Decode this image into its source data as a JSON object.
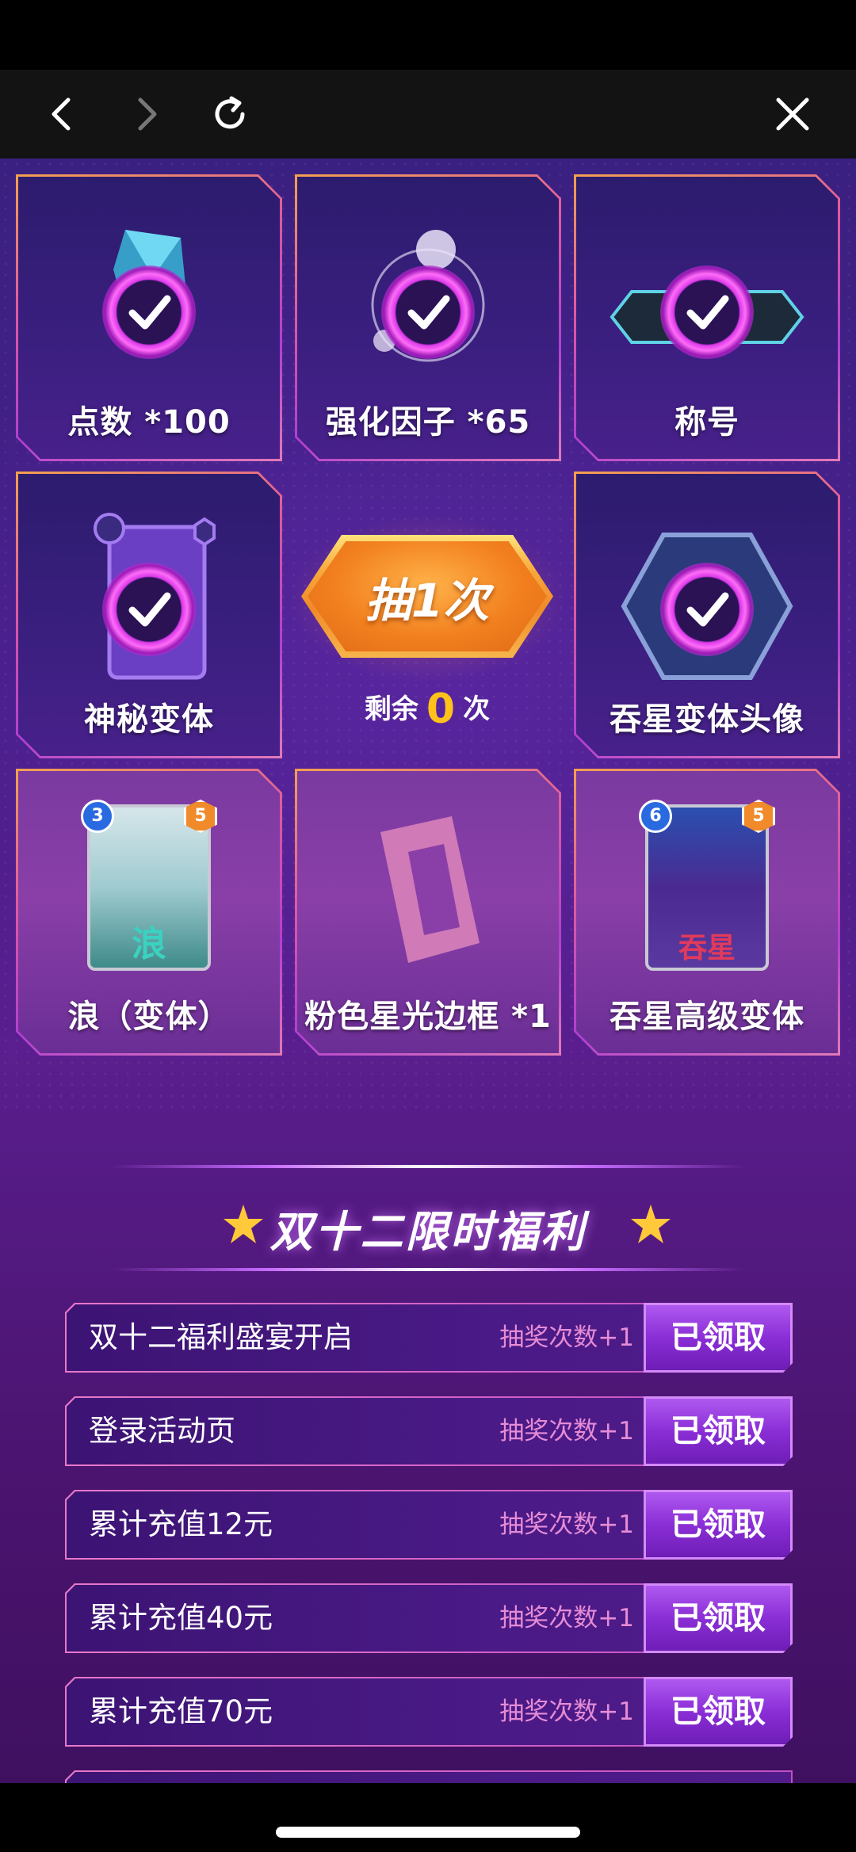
{
  "nav": {
    "icons": [
      "back-icon",
      "forward-icon",
      "refresh-icon",
      "close-icon"
    ]
  },
  "rewards": [
    {
      "label": "点数 *100",
      "owned": true
    },
    {
      "label": "强化因子 *65",
      "owned": true
    },
    {
      "label": "称号",
      "owned": true
    },
    {
      "label": "神秘变体",
      "owned": true
    },
    {
      "label": "吞星变体头像",
      "owned": true
    },
    {
      "label": "浪（变体）",
      "cost": "3",
      "power": "5",
      "art_text": "浪"
    },
    {
      "label": "粉色星光边框 *1"
    },
    {
      "label": "吞星高级变体",
      "cost": "6",
      "power": "5",
      "art_text": "吞星"
    }
  ],
  "draw": {
    "button_label": "抽1次",
    "remaining_prefix": "剩余",
    "remaining_count": "0",
    "remaining_suffix": "次"
  },
  "section": {
    "title": "双十二限时福利"
  },
  "tasks": [
    {
      "name": "双十二福利盛宴开启",
      "bonus": "抽奖次数+1",
      "status": "已领取"
    },
    {
      "name": "登录活动页",
      "bonus": "抽奖次数+1",
      "status": "已领取"
    },
    {
      "name": "累计充值12元",
      "bonus": "抽奖次数+1",
      "status": "已领取"
    },
    {
      "name": "累计充值40元",
      "bonus": "抽奖次数+1",
      "status": "已领取"
    },
    {
      "name": "累计充值70元",
      "bonus": "抽奖次数+1",
      "status": "已领取"
    }
  ],
  "colors": {
    "accent_orange": "#f08a2a",
    "check_magenta": "#d838e8",
    "bonus_pink": "#e68cd6",
    "count_yellow": "#ffc21a"
  }
}
